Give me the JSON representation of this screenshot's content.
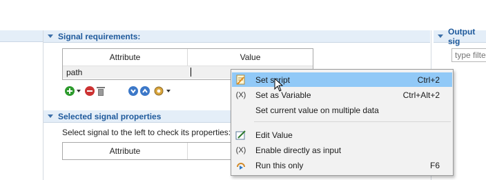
{
  "signal_requirements": {
    "title": "Signal requirements:",
    "table": {
      "columns": [
        "Attribute",
        "Value"
      ],
      "rows": [
        {
          "attribute": "path",
          "value": ""
        }
      ]
    }
  },
  "selected_signal_properties": {
    "title": "Selected signal properties",
    "hint": "Select signal to the left to check its properties:",
    "table": {
      "columns": [
        "Attribute"
      ]
    }
  },
  "output_signals": {
    "title": "Output sig",
    "filter_placeholder": "type filte"
  },
  "context_menu": {
    "items": [
      {
        "label": "Set script",
        "shortcut": "Ctrl+2",
        "icon": "script-icon",
        "highlighted": true
      },
      {
        "label": "Set as Variable",
        "shortcut": "Ctrl+Alt+2",
        "icon": "variable-icon",
        "glyph": "(X)"
      },
      {
        "label": "Set current value on multiple data",
        "shortcut": "",
        "icon": ""
      },
      {
        "label": "Edit Value",
        "shortcut": "",
        "icon": "edit-value-icon"
      },
      {
        "label": "Enable directly as input",
        "shortcut": "",
        "icon": "variable-icon",
        "glyph": "(X)"
      },
      {
        "label": "Run this only",
        "shortcut": "F6",
        "icon": "run-icon"
      }
    ]
  },
  "colors": {
    "header_bg": "#e4eef8",
    "header_text": "#1f5a9c",
    "menu_highlight": "#91c9f7",
    "add_green": "#2e9b2e",
    "remove_red": "#cc3333",
    "arrow_blue": "#3c78c8"
  }
}
